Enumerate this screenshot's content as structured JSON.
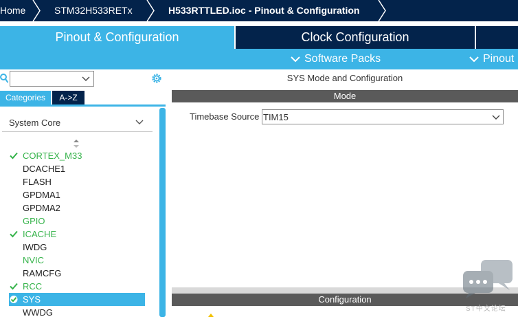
{
  "breadcrumb": {
    "items": [
      "Home",
      "STM32H533RETx",
      "H533RTTLED.ioc - Pinout & Configuration"
    ]
  },
  "tabs": {
    "pinout": "Pinout & Configuration",
    "clock": "Clock Configuration"
  },
  "submenu": {
    "software_packs": "Software Packs",
    "pinout": "Pinout"
  },
  "left": {
    "search_value": "",
    "category_tabs": [
      "Categories",
      "A->Z"
    ],
    "group": "System Core",
    "items": [
      {
        "label": "CORTEX_M33",
        "status": "ok",
        "checked": true
      },
      {
        "label": "DCACHE1",
        "status": "plain",
        "checked": false
      },
      {
        "label": "FLASH",
        "status": "plain",
        "checked": false
      },
      {
        "label": "GPDMA1",
        "status": "plain",
        "checked": false
      },
      {
        "label": "GPDMA2",
        "status": "plain",
        "checked": false
      },
      {
        "label": "GPIO",
        "status": "ok",
        "checked": false
      },
      {
        "label": "ICACHE",
        "status": "ok",
        "checked": true
      },
      {
        "label": "IWDG",
        "status": "plain",
        "checked": false
      },
      {
        "label": "NVIC",
        "status": "ok",
        "checked": false
      },
      {
        "label": "RAMCFG",
        "status": "plain",
        "checked": false
      },
      {
        "label": "RCC",
        "status": "ok",
        "checked": true
      },
      {
        "label": "SYS",
        "status": "selected",
        "checked": true
      },
      {
        "label": "WWDG",
        "status": "plain",
        "checked": false
      }
    ]
  },
  "right": {
    "title": "SYS Mode and Configuration",
    "mode_header": "Mode",
    "timebase_label": "Timebase Source",
    "timebase_value": "TIM15",
    "config_header": "Configuration"
  },
  "colors": {
    "navy": "#03234b",
    "accent": "#3cb4e6",
    "ok_green": "#35b34a"
  },
  "watermark": {
    "text": "ST中文论坛"
  }
}
